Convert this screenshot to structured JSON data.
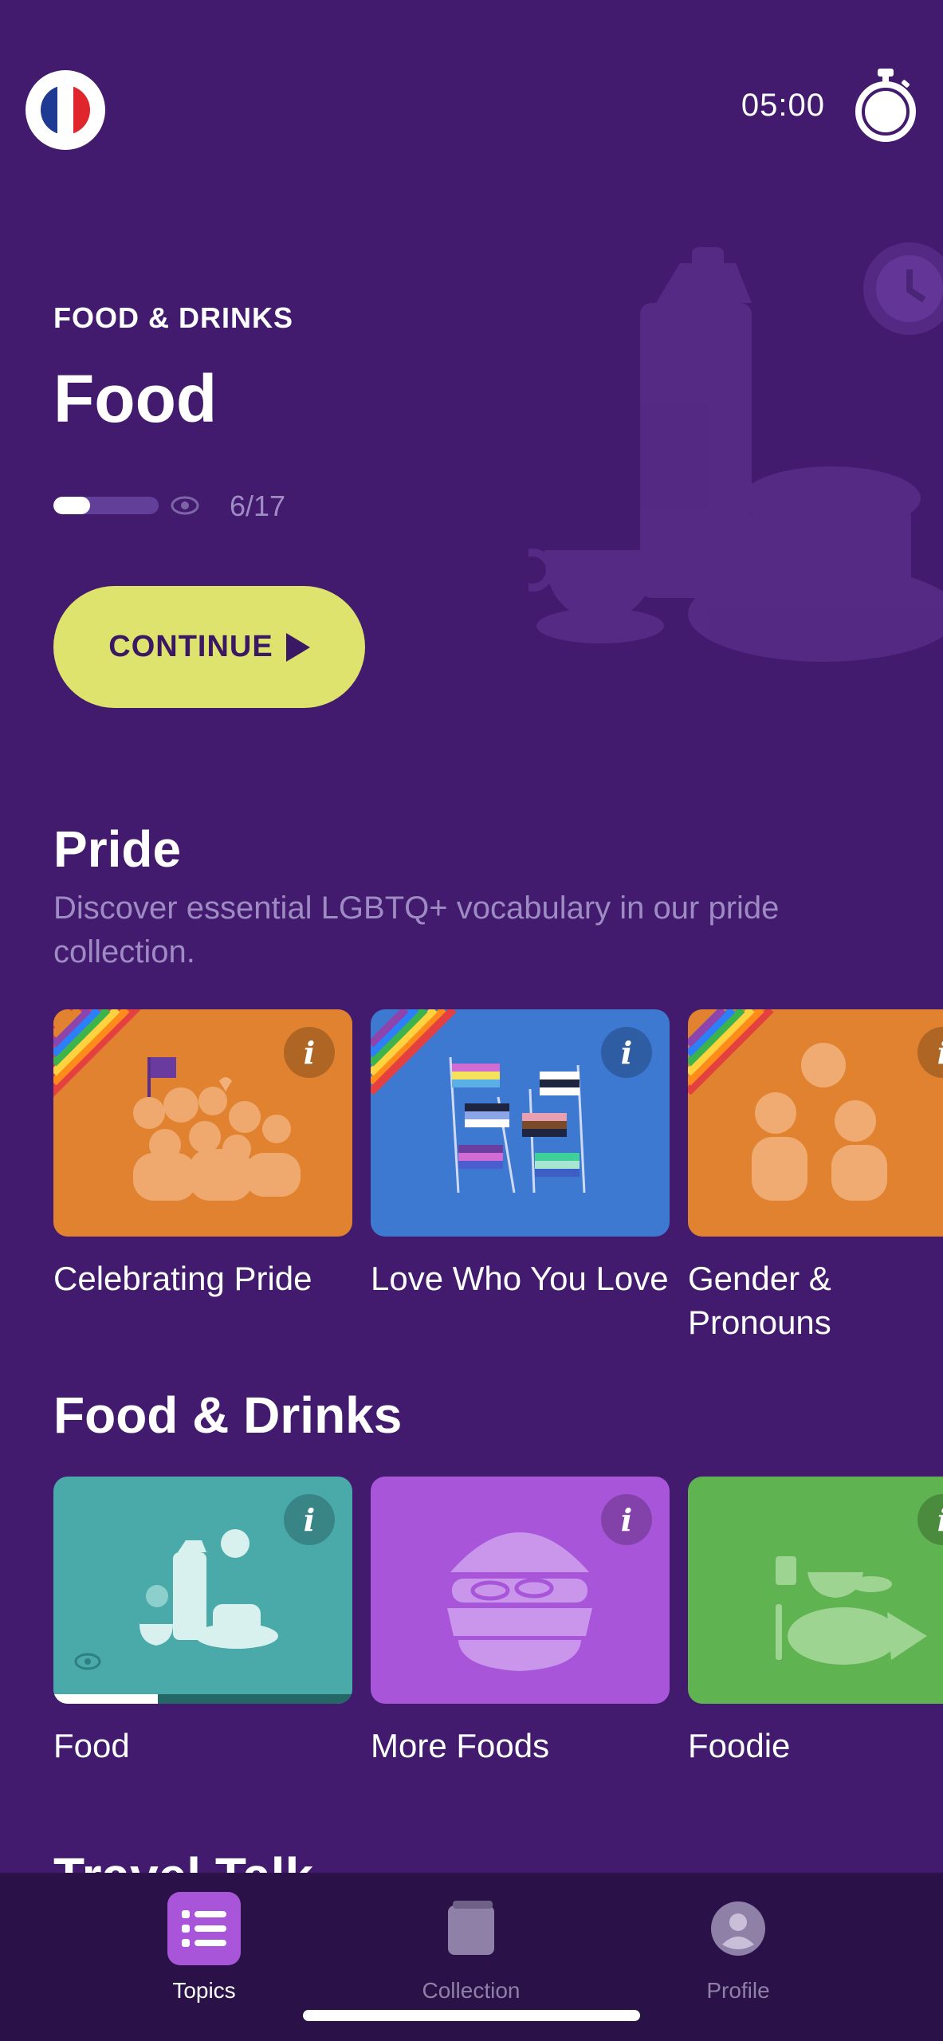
{
  "header": {
    "language_flag": "france-flag-icon",
    "timer": "05:00",
    "timer_icon": "stopwatch-icon"
  },
  "hero": {
    "category": "FOOD & DRINKS",
    "title": "Food",
    "progress_text": "6/17",
    "progress_fraction": 0.35,
    "continue_label": "CONTINUE"
  },
  "sections": {
    "pride": {
      "title": "Pride",
      "description": "Discover essential LGBTQ+ vocabulary in our pride collection.",
      "cards": [
        {
          "label": "Celebrating Pride",
          "color": "#e0822f"
        },
        {
          "label": "Love Who You Love",
          "color": "#3d78d1"
        },
        {
          "label": "Gender & Pronouns",
          "color": "#e0822f"
        }
      ]
    },
    "food_drinks": {
      "title": "Food & Drinks",
      "cards": [
        {
          "label": "Food",
          "color": "#4aa9a9",
          "progress_fraction": 0.35
        },
        {
          "label": "More Foods",
          "color": "#a855d9"
        },
        {
          "label": "Foodie",
          "color": "#5fb350"
        }
      ]
    },
    "travel": {
      "title": "Travel Talk"
    }
  },
  "info_glyph": "i",
  "nav": {
    "items": [
      {
        "label": "Topics",
        "icon": "list-icon",
        "active": true
      },
      {
        "label": "Collection",
        "icon": "book-icon",
        "active": false
      },
      {
        "label": "Profile",
        "icon": "profile-icon",
        "active": false
      }
    ]
  },
  "colors": {
    "background": "#421b6e",
    "accent": "#dde36c",
    "nav_background": "#2a1147",
    "nav_active": "#a855d9"
  }
}
